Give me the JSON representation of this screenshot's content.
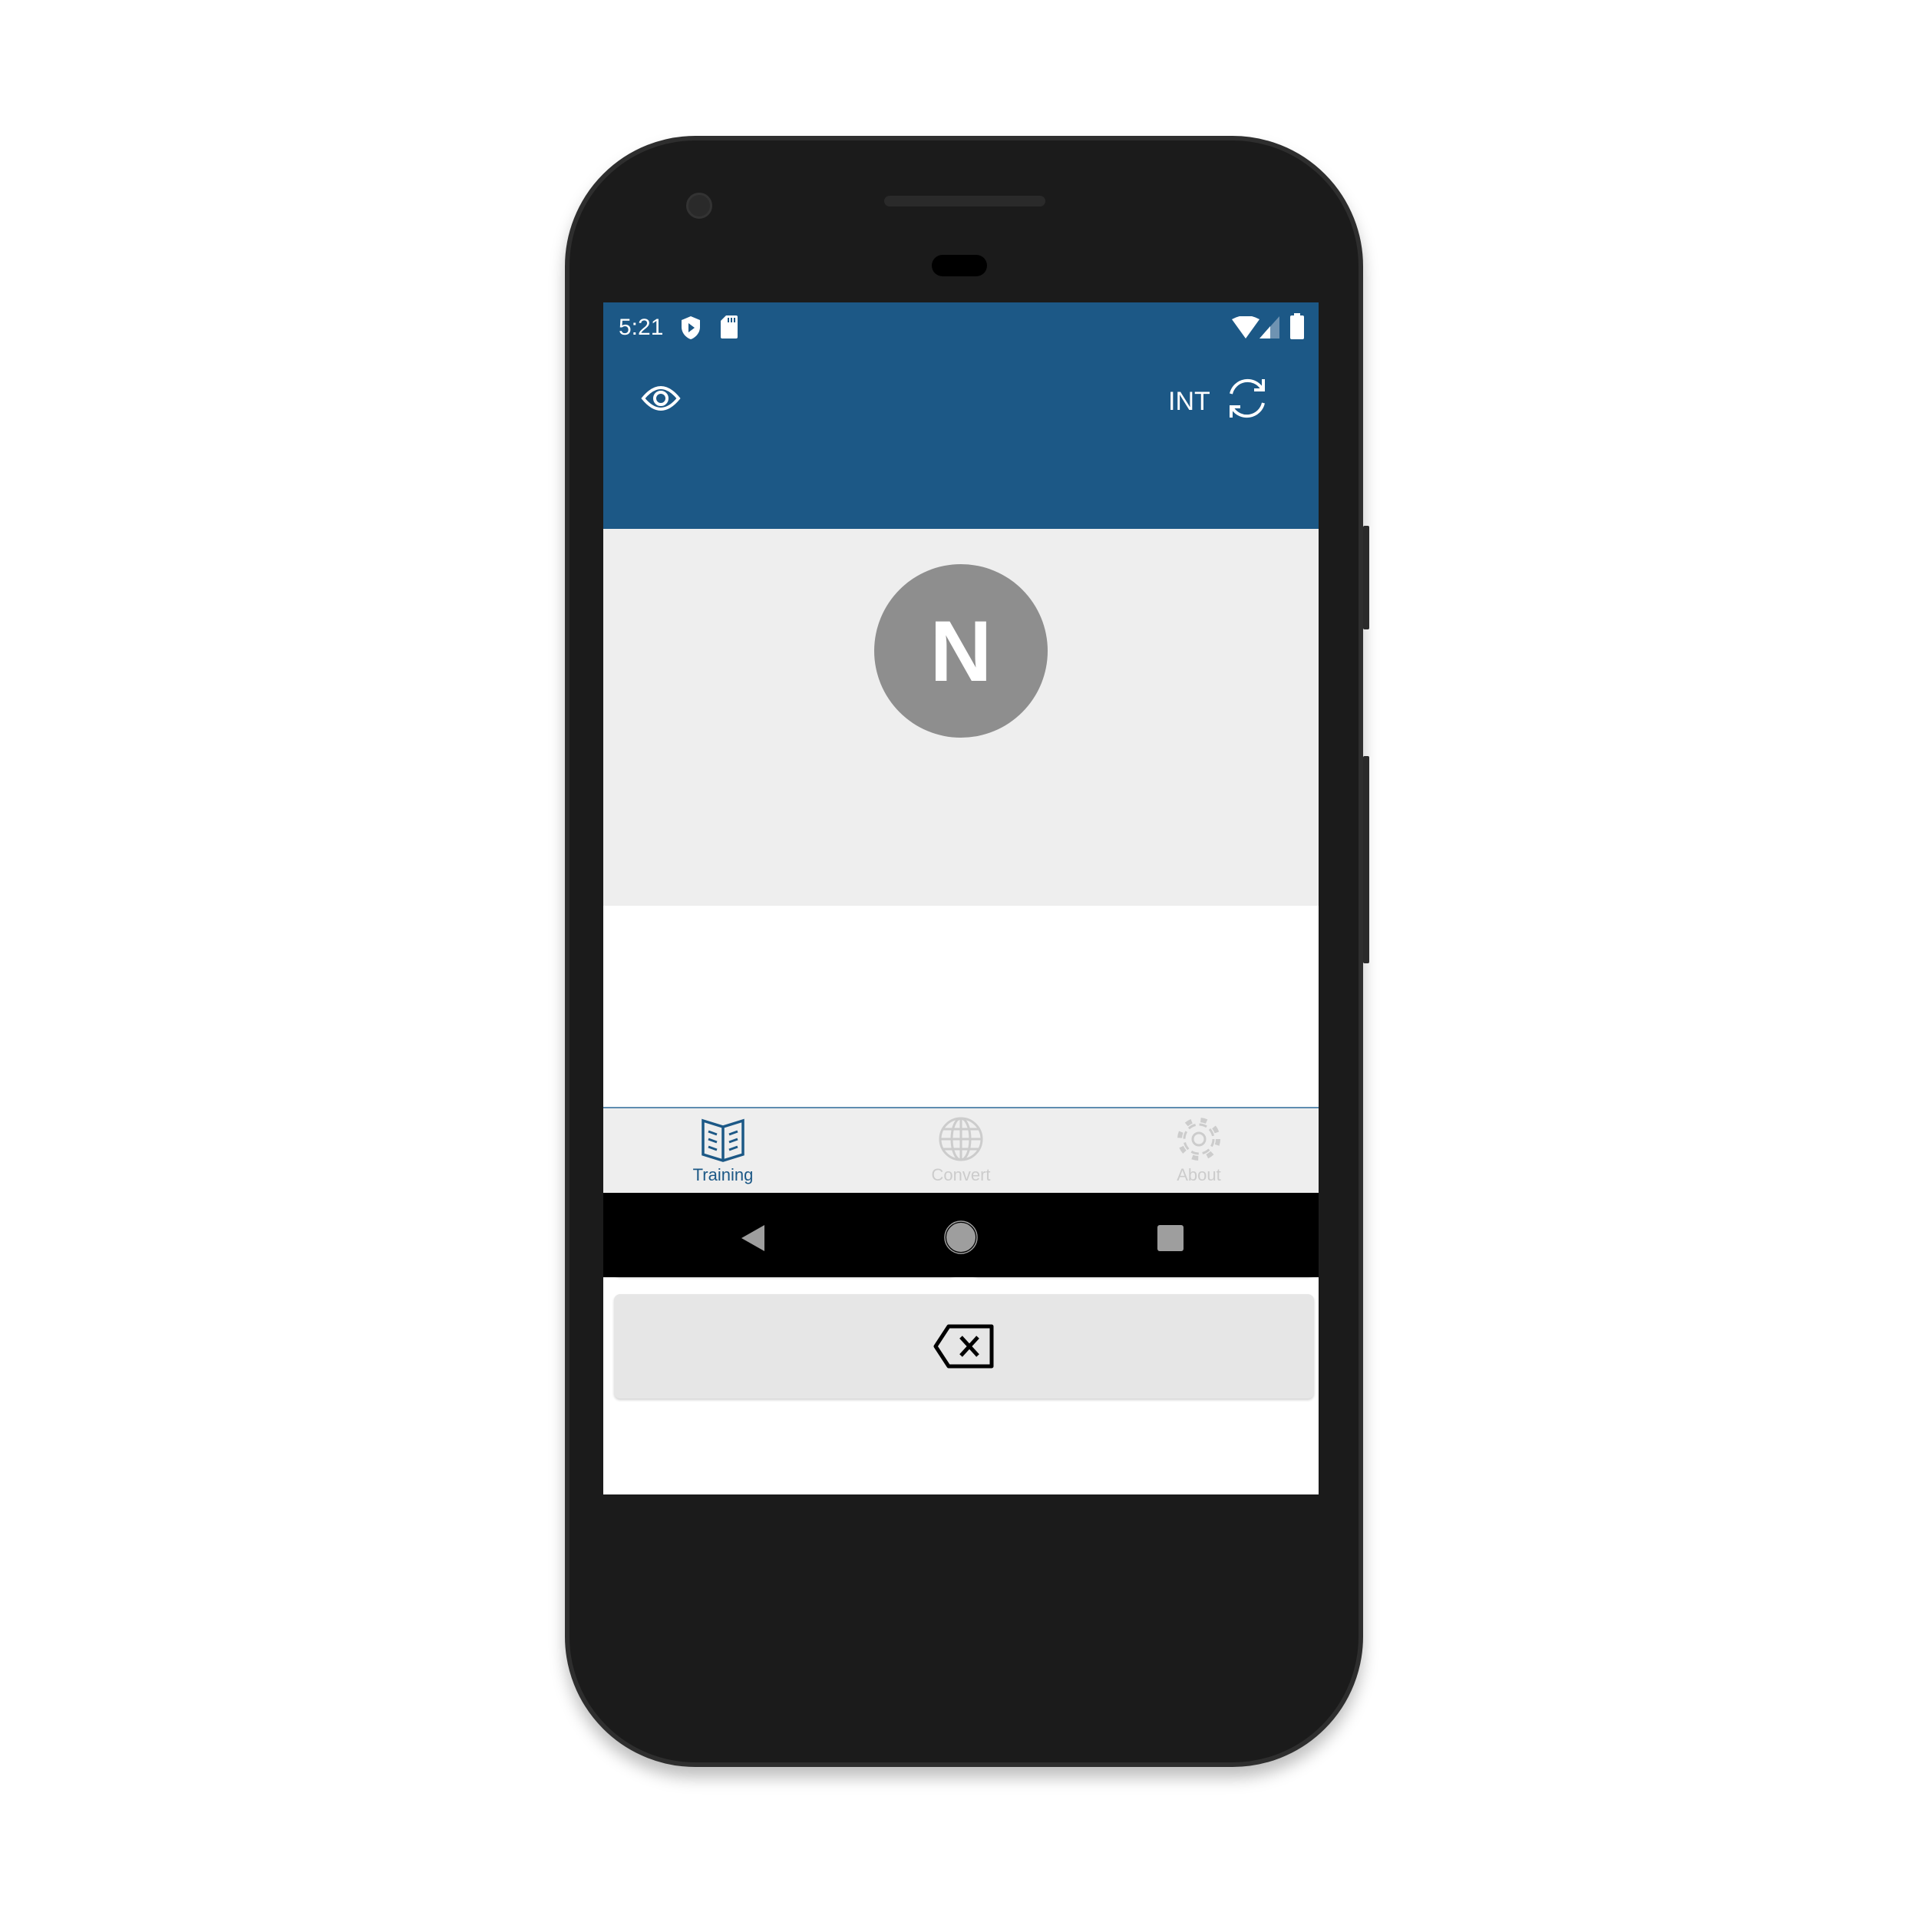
{
  "status_bar": {
    "time": "5:21",
    "icons": [
      "play-protect-icon",
      "sd-card-icon",
      "wifi-icon",
      "signal-icon",
      "battery-icon"
    ]
  },
  "toolbar": {
    "left_icon": "eye-icon",
    "mode_label": "INT",
    "right_icon": "refresh-icon"
  },
  "training": {
    "letter": "N",
    "dot_key": "dot",
    "dash_key": "dash",
    "backspace_key": "backspace-icon"
  },
  "tabs": [
    {
      "label": "Training",
      "icon": "book-icon",
      "active": true
    },
    {
      "label": "Convert",
      "icon": "globe-icon",
      "active": false
    },
    {
      "label": "About",
      "icon": "gear-icon",
      "active": false
    }
  ],
  "colors": {
    "primary": "#1c5886",
    "inactive": "#cccccc",
    "letter_circle": "#8e8e8e"
  }
}
